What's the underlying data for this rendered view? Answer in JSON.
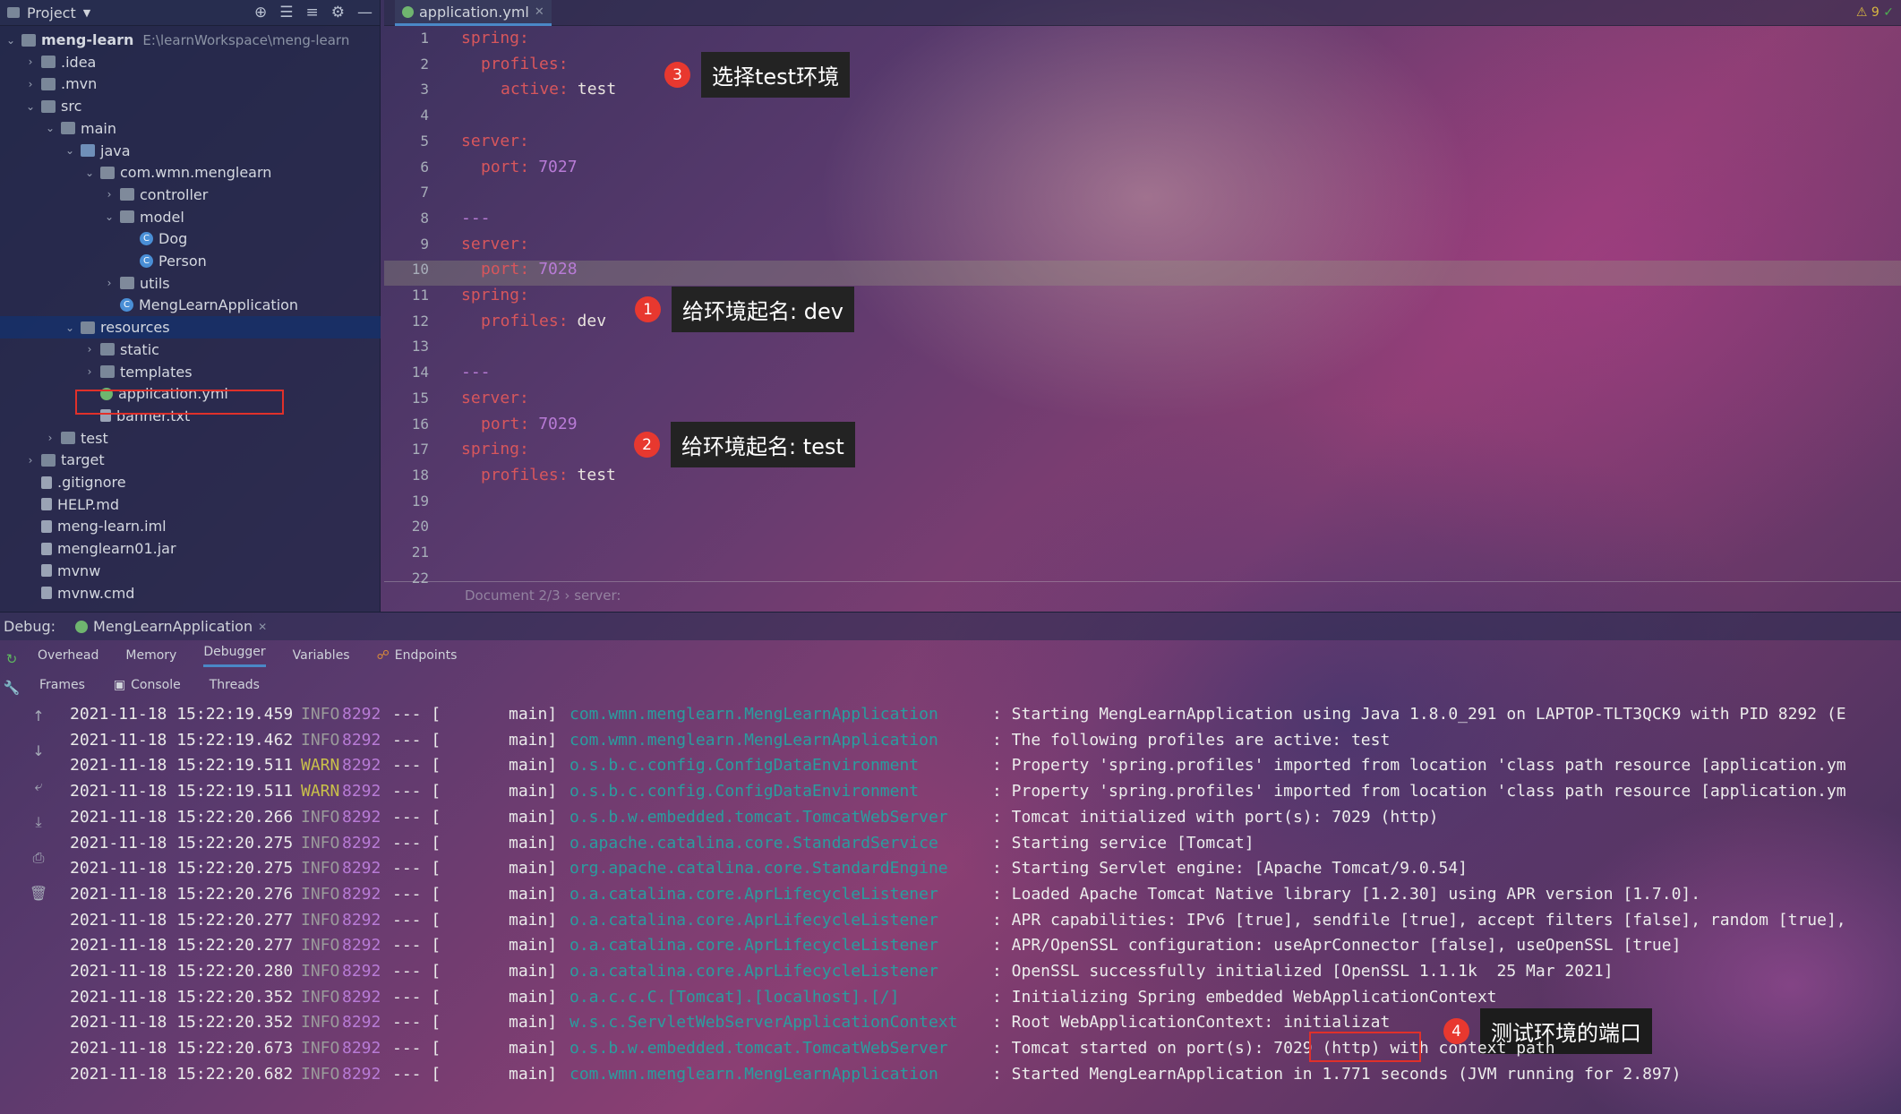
{
  "project": {
    "title": "Project",
    "root": {
      "name": "meng-learn",
      "path": "E:\\learnWorkspace\\meng-learn"
    },
    "tree": [
      {
        "label": "meng-learn",
        "level": 0,
        "icon": "folder",
        "open": true
      },
      {
        "label": ".idea",
        "level": 1,
        "icon": "folder"
      },
      {
        "label": ".mvn",
        "level": 1,
        "icon": "folder"
      },
      {
        "label": "src",
        "level": 1,
        "icon": "folder",
        "open": true
      },
      {
        "label": "main",
        "level": 2,
        "icon": "folder",
        "open": true
      },
      {
        "label": "java",
        "level": 3,
        "icon": "folder-src",
        "open": true
      },
      {
        "label": "com.wmn.menglearn",
        "level": 4,
        "icon": "package",
        "open": true
      },
      {
        "label": "controller",
        "level": 5,
        "icon": "package"
      },
      {
        "label": "model",
        "level": 5,
        "icon": "package",
        "open": true
      },
      {
        "label": "Dog",
        "level": 6,
        "icon": "class"
      },
      {
        "label": "Person",
        "level": 6,
        "icon": "class"
      },
      {
        "label": "utils",
        "level": 5,
        "icon": "package"
      },
      {
        "label": "MengLearnApplication",
        "level": 5,
        "icon": "class"
      },
      {
        "label": "resources",
        "level": 3,
        "icon": "folder",
        "open": true,
        "selected": true
      },
      {
        "label": "static",
        "level": 4,
        "icon": "folder"
      },
      {
        "label": "templates",
        "level": 4,
        "icon": "folder"
      },
      {
        "label": "application.yml",
        "level": 4,
        "icon": "yml"
      },
      {
        "label": "banner.txt",
        "level": 4,
        "icon": "file"
      },
      {
        "label": "test",
        "level": 2,
        "icon": "folder"
      },
      {
        "label": "target",
        "level": 1,
        "icon": "folder"
      },
      {
        "label": ".gitignore",
        "level": 1,
        "icon": "file"
      },
      {
        "label": "HELP.md",
        "level": 1,
        "icon": "file"
      },
      {
        "label": "meng-learn.iml",
        "level": 1,
        "icon": "file"
      },
      {
        "label": "menglearn01.jar",
        "level": 1,
        "icon": "file"
      },
      {
        "label": "mvnw",
        "level": 1,
        "icon": "file"
      },
      {
        "label": "mvnw.cmd",
        "level": 1,
        "icon": "file"
      }
    ]
  },
  "editor": {
    "tab": "application.yml",
    "inspections": "9",
    "lines": [
      {
        "no": "1",
        "key": "spring:",
        "val": "",
        "indent": 0
      },
      {
        "no": "2",
        "key": "profiles:",
        "val": "",
        "indent": 1
      },
      {
        "no": "3",
        "key": "active:",
        "val": "test",
        "indent": 2
      },
      {
        "no": "4",
        "key": "",
        "val": "",
        "indent": 0
      },
      {
        "no": "5",
        "key": "server:",
        "val": "",
        "indent": 0
      },
      {
        "no": "6",
        "key": "port:",
        "val": "7027",
        "indent": 1,
        "num": true
      },
      {
        "no": "7",
        "key": "",
        "val": "",
        "indent": 0
      },
      {
        "no": "8",
        "key": "---",
        "val": "",
        "indent": 0,
        "sep": true
      },
      {
        "no": "9",
        "key": "server:",
        "val": "",
        "indent": 0
      },
      {
        "no": "10",
        "key": "port:",
        "val": "7028",
        "indent": 1,
        "num": true
      },
      {
        "no": "11",
        "key": "spring:",
        "val": "",
        "indent": 0
      },
      {
        "no": "12",
        "key": "profiles:",
        "val": "dev",
        "indent": 1
      },
      {
        "no": "13",
        "key": "",
        "val": "",
        "indent": 0
      },
      {
        "no": "14",
        "key": "---",
        "val": "",
        "indent": 0,
        "sep": true
      },
      {
        "no": "15",
        "key": "server:",
        "val": "",
        "indent": 0
      },
      {
        "no": "16",
        "key": "port:",
        "val": "7029",
        "indent": 1,
        "num": true
      },
      {
        "no": "17",
        "key": "spring:",
        "val": "",
        "indent": 0
      },
      {
        "no": "18",
        "key": "profiles:",
        "val": "test",
        "indent": 1
      },
      {
        "no": "19",
        "key": "",
        "val": "",
        "indent": 0
      },
      {
        "no": "20",
        "key": "",
        "val": "",
        "indent": 0
      },
      {
        "no": "21",
        "key": "",
        "val": "",
        "indent": 0
      },
      {
        "no": "22",
        "key": "",
        "val": "",
        "indent": 0
      }
    ],
    "breadcrumb": [
      "Document 2/3",
      "server:"
    ]
  },
  "annotations": [
    {
      "num": "3",
      "text": "选择test环境"
    },
    {
      "num": "1",
      "text": "给环境起名: dev"
    },
    {
      "num": "2",
      "text": "给环境起名: test"
    },
    {
      "num": "4",
      "text": "测试环境的端口"
    }
  ],
  "debug": {
    "label": "Debug:",
    "config": "MengLearnApplication",
    "tabs": [
      "Overhead",
      "Memory",
      "Debugger",
      "Variables",
      "Endpoints"
    ],
    "active_tab": "Debugger",
    "subtabs": [
      "Frames",
      "Console",
      "Threads"
    ]
  },
  "logs": [
    {
      "ts": "2021-11-18 15:22:19.459",
      "lvl": "INFO",
      "pid": "8292",
      "cat": "com.wmn.menglearn.MengLearnApplication",
      "msg": ": Starting MengLearnApplication using Java 1.8.0_291 on LAPTOP-TLT3QCK9 with PID 8292 (E"
    },
    {
      "ts": "2021-11-18 15:22:19.462",
      "lvl": "INFO",
      "pid": "8292",
      "cat": "com.wmn.menglearn.MengLearnApplication",
      "msg": ": The following profiles are active: test"
    },
    {
      "ts": "2021-11-18 15:22:19.511",
      "lvl": "WARN",
      "pid": "8292",
      "cat": "o.s.b.c.config.ConfigDataEnvironment",
      "msg": ": Property 'spring.profiles' imported from location 'class path resource [application.ym"
    },
    {
      "ts": "2021-11-18 15:22:19.511",
      "lvl": "WARN",
      "pid": "8292",
      "cat": "o.s.b.c.config.ConfigDataEnvironment",
      "msg": ": Property 'spring.profiles' imported from location 'class path resource [application.ym"
    },
    {
      "ts": "2021-11-18 15:22:20.266",
      "lvl": "INFO",
      "pid": "8292",
      "cat": "o.s.b.w.embedded.tomcat.TomcatWebServer",
      "msg": ": Tomcat initialized with port(s): 7029 (http)"
    },
    {
      "ts": "2021-11-18 15:22:20.275",
      "lvl": "INFO",
      "pid": "8292",
      "cat": "o.apache.catalina.core.StandardService",
      "msg": ": Starting service [Tomcat]"
    },
    {
      "ts": "2021-11-18 15:22:20.275",
      "lvl": "INFO",
      "pid": "8292",
      "cat": "org.apache.catalina.core.StandardEngine",
      "msg": ": Starting Servlet engine: [Apache Tomcat/9.0.54]"
    },
    {
      "ts": "2021-11-18 15:22:20.276",
      "lvl": "INFO",
      "pid": "8292",
      "cat": "o.a.catalina.core.AprLifecycleListener",
      "msg": ": Loaded Apache Tomcat Native library [1.2.30] using APR version [1.7.0]."
    },
    {
      "ts": "2021-11-18 15:22:20.277",
      "lvl": "INFO",
      "pid": "8292",
      "cat": "o.a.catalina.core.AprLifecycleListener",
      "msg": ": APR capabilities: IPv6 [true], sendfile [true], accept filters [false], random [true],"
    },
    {
      "ts": "2021-11-18 15:22:20.277",
      "lvl": "INFO",
      "pid": "8292",
      "cat": "o.a.catalina.core.AprLifecycleListener",
      "msg": ": APR/OpenSSL configuration: useAprConnector [false], useOpenSSL [true]"
    },
    {
      "ts": "2021-11-18 15:22:20.280",
      "lvl": "INFO",
      "pid": "8292",
      "cat": "o.a.catalina.core.AprLifecycleListener",
      "msg": ": OpenSSL successfully initialized [OpenSSL 1.1.1k  25 Mar 2021]"
    },
    {
      "ts": "2021-11-18 15:22:20.352",
      "lvl": "INFO",
      "pid": "8292",
      "cat": "o.a.c.c.C.[Tomcat].[localhost].[/]",
      "msg": ": Initializing Spring embedded WebApplicationContext"
    },
    {
      "ts": "2021-11-18 15:22:20.352",
      "lvl": "INFO",
      "pid": "8292",
      "cat": "w.s.c.ServletWebServerApplicationContext",
      "msg": ": Root WebApplicationContext: initializat"
    },
    {
      "ts": "2021-11-18 15:22:20.673",
      "lvl": "INFO",
      "pid": "8292",
      "cat": "o.s.b.w.embedded.tomcat.TomcatWebServer",
      "msg": ": Tomcat started on port(s): 7029 (http) with context path"
    },
    {
      "ts": "2021-11-18 15:22:20.682",
      "lvl": "INFO",
      "pid": "8292",
      "cat": "com.wmn.menglearn.MengLearnApplication",
      "msg": ": Started MengLearnApplication in 1.771 seconds (JVM running for 2.897)"
    }
  ],
  "log_common": {
    "sep": "--- [",
    "thread": "main]"
  }
}
